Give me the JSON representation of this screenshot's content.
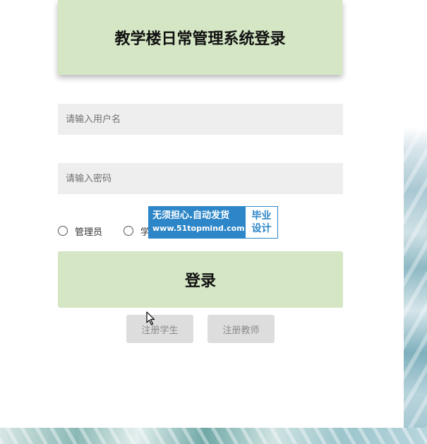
{
  "login": {
    "title": "教学楼日常管理系统登录",
    "username_placeholder": "请输入用户名",
    "password_placeholder": "请输入密码",
    "roles": [
      "管理员",
      "学"
    ],
    "login_label": "登录",
    "register_student_label": "注册学生",
    "register_teacher_label": "注册教师"
  },
  "watermark": {
    "line1": "无须担心.自动发货",
    "line2": "www.51topmind.com",
    "badge_line1": "毕业",
    "badge_line2": "设计"
  },
  "colors": {
    "accent_green": "#d4e6c4",
    "input_bg": "#eeeeee",
    "register_bg": "#dddddd",
    "watermark_blue": "#2c86c8"
  },
  "icons": {
    "cursor": "mouse-pointer-icon"
  }
}
